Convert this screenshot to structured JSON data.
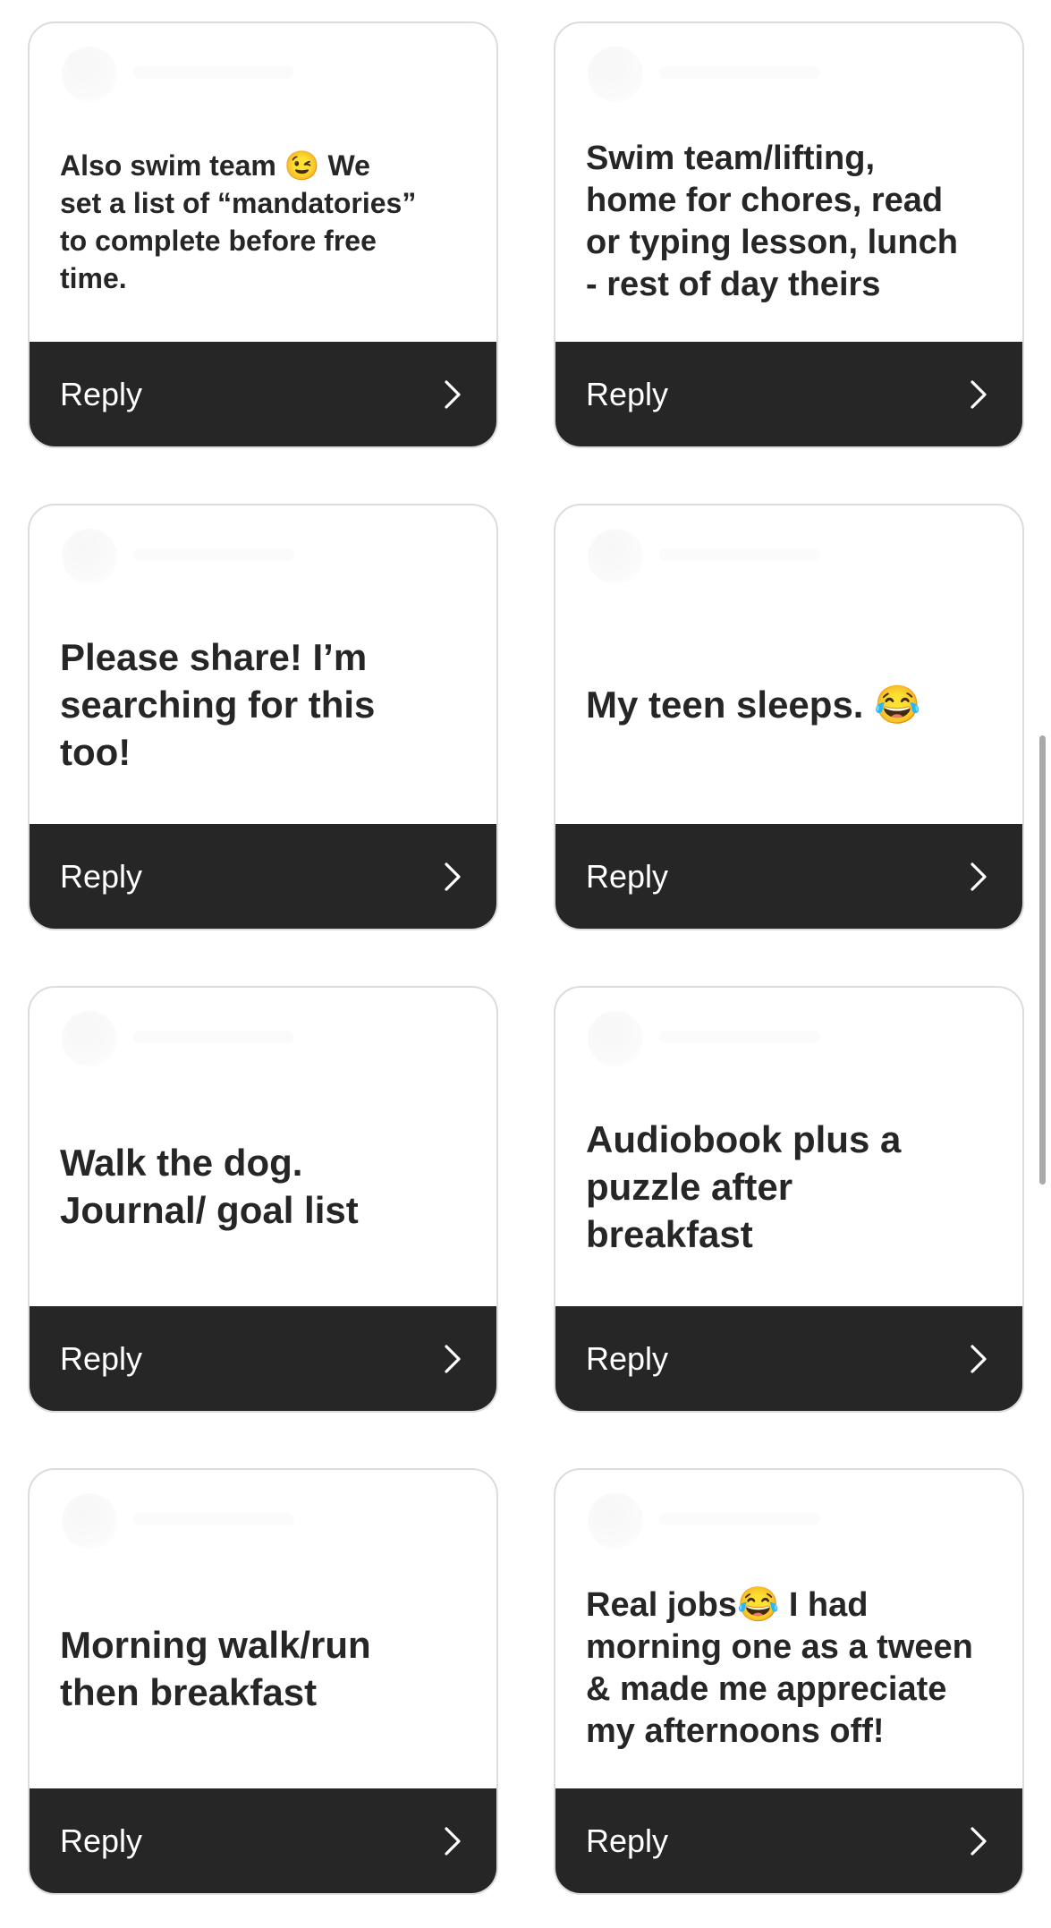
{
  "cards": [
    {
      "message": "Also swim team 😉 We\nset a list of “mandatories”\nto complete before free\ntime.",
      "reply_label": "Reply"
    },
    {
      "message": "Swim team/lifting,\nhome for chores, read\nor typing lesson, lunch\n- rest of day theirs",
      "reply_label": "Reply"
    },
    {
      "message": "Please share! I’m\nsearching for this\ntoo!",
      "reply_label": "Reply"
    },
    {
      "message": "My teen sleeps. 😂",
      "reply_label": "Reply"
    },
    {
      "message": "Walk the dog.\nJournal/ goal list",
      "reply_label": "Reply"
    },
    {
      "message": "Audiobook plus a\npuzzle after\nbreakfast",
      "reply_label": "Reply"
    },
    {
      "message": "Morning walk/run\nthen breakfast",
      "reply_label": "Reply"
    },
    {
      "message": "Real jobs😂 I had\nmorning one as a tween\n& made me appreciate\nmy afternoons off!",
      "reply_label": "Reply"
    }
  ],
  "icons": {
    "reply_arrow": "chevron-right-icon"
  },
  "colors": {
    "reply_bar": "#262626",
    "card_border": "#dcdcdc",
    "message_text": "#262626",
    "reply_text": "#ffffff",
    "scrollbar": "#a9a9a9"
  }
}
